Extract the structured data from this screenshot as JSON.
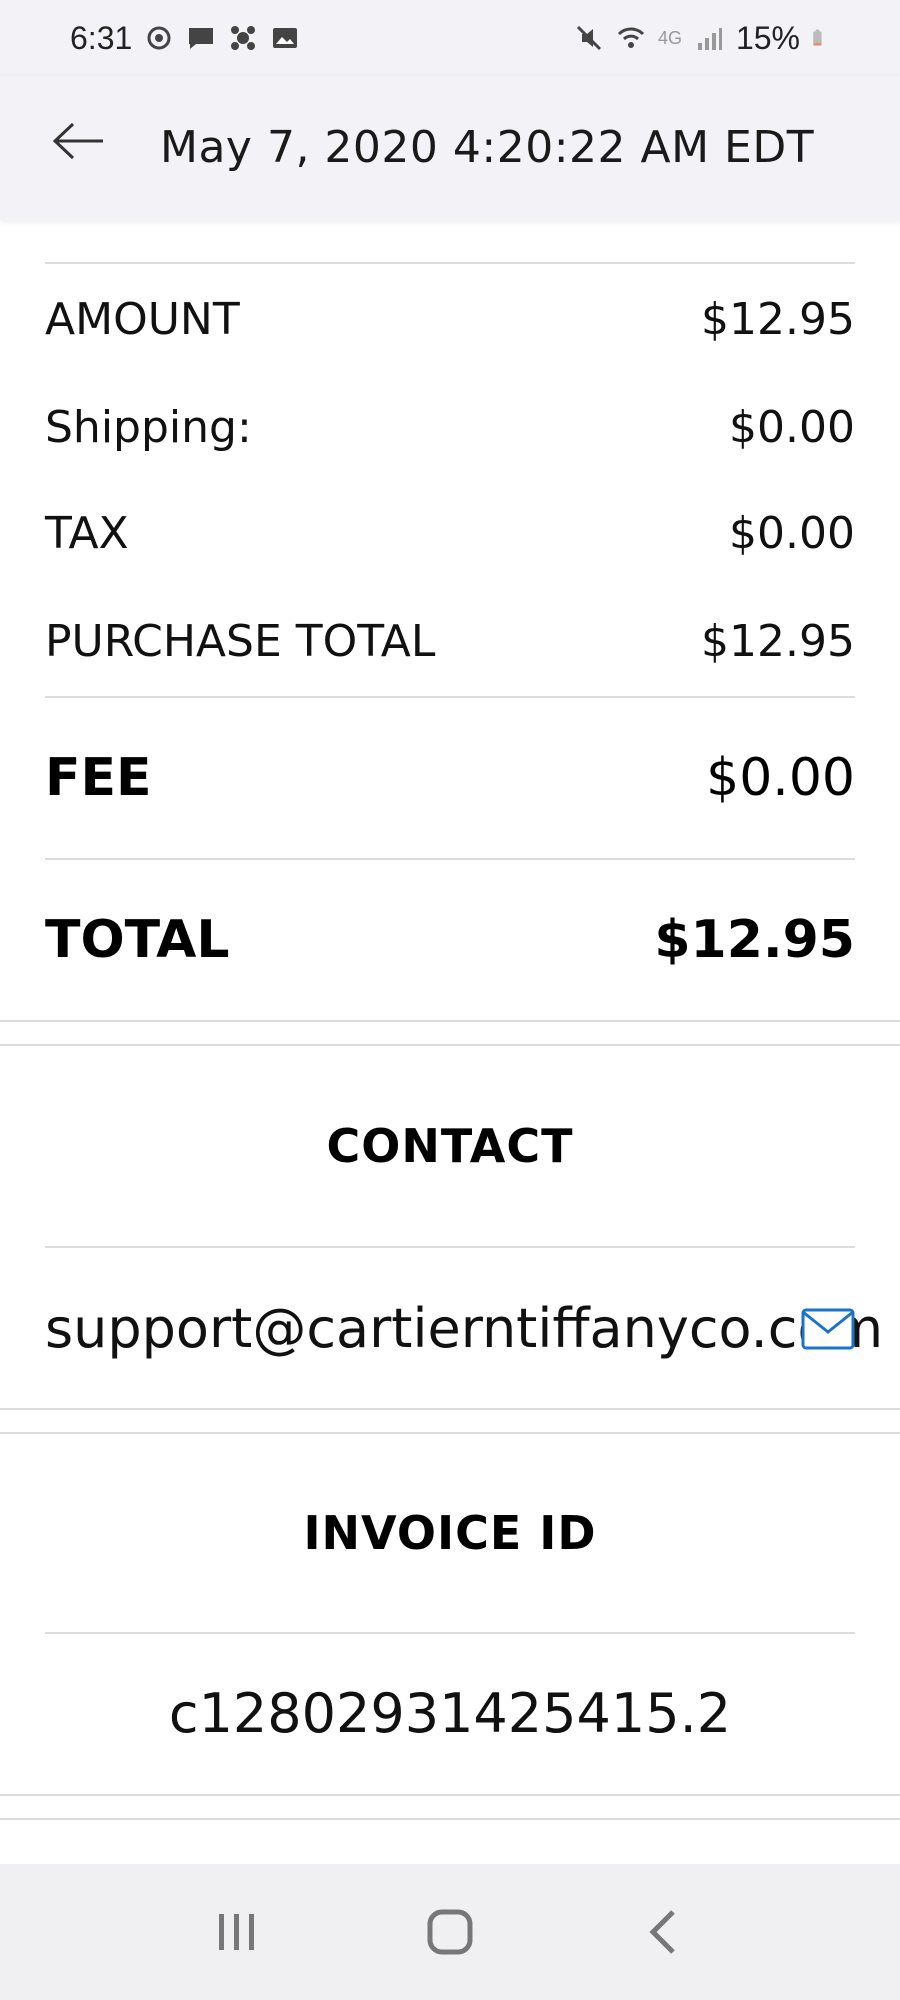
{
  "status_bar": {
    "time": "6:31",
    "network": "4G",
    "battery": "15%",
    "left_icons": [
      "sync-icon",
      "message-icon",
      "app-icon",
      "image-icon"
    ],
    "right_icons": [
      "mute-icon",
      "wifi-icon",
      "signal-icon",
      "battery-icon"
    ]
  },
  "header": {
    "title": "May 7, 2020 4:20:22 AM EDT",
    "back_icon": "back-arrow-icon"
  },
  "summary": {
    "items": [
      {
        "label": "AMOUNT",
        "value": "$12.95"
      },
      {
        "label": "Shipping:",
        "value": "$0.00"
      },
      {
        "label": "TAX",
        "value": "$0.00"
      },
      {
        "label": "PURCHASE TOTAL",
        "value": "$12.95"
      }
    ],
    "fee": {
      "label": "FEE",
      "value": "$0.00"
    },
    "total": {
      "label": "TOTAL",
      "value": "$12.95"
    }
  },
  "contact": {
    "title": "CONTACT",
    "email": "support@cartierntiffanyco.com",
    "icon": "mail-icon",
    "accent_color": "#1a73c8"
  },
  "invoice": {
    "title": "INVOICE ID",
    "value": "c12802931425415.2"
  },
  "nav_bar": {
    "icons": [
      "recent-apps-icon",
      "home-icon",
      "back-icon"
    ]
  }
}
